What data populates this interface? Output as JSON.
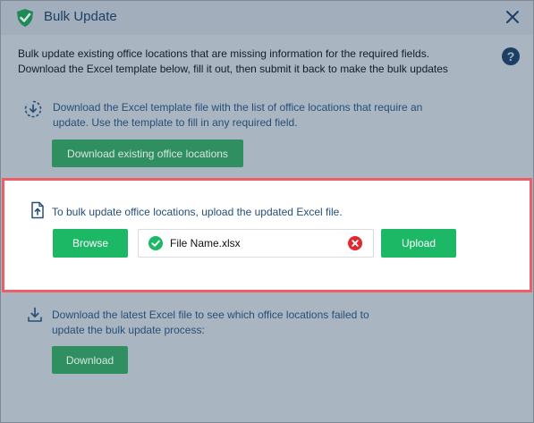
{
  "dialog": {
    "title": "Bulk Update",
    "intro_line1": "Bulk update existing office locations that are missing information for the required fields.",
    "intro_line2": "Download the Excel template below, fill it out, then submit it back to make the bulk updates"
  },
  "step_download_template": {
    "text_line1": "Download the Excel template file with the list of office locations that require an",
    "text_line2": "update. Use the template to fill in any required field.",
    "button_label": "Download existing office locations"
  },
  "step_upload": {
    "text": "To bulk update office locations, upload the updated Excel file.",
    "browse_label": "Browse",
    "file_name": "File Name.xlsx",
    "upload_label": "Upload"
  },
  "step_download_latest": {
    "text_line1": "Download the latest Excel file to see which office locations failed to",
    "text_line2": "update the bulk update process:",
    "button_label": "Download"
  },
  "icons": {
    "app": "checkmark-shield-icon",
    "close": "close-icon",
    "help": "help-icon",
    "download_template": "download-circle-icon",
    "upload": "upload-file-icon",
    "download_latest": "download-tray-icon",
    "file_ok": "check-circle-icon",
    "file_remove": "remove-circle-icon"
  },
  "colors": {
    "primary_green": "#1db866",
    "muted_green": "#2f8f61",
    "highlight_border": "#ec5f67",
    "remove_red": "#e0282e",
    "link_blue": "#264f78",
    "overlay": "#a9b5c0"
  }
}
